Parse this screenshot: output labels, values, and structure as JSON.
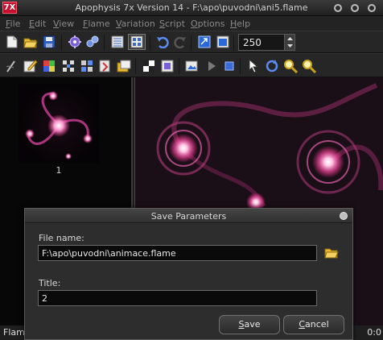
{
  "window": {
    "title": "Apophysis 7x Version 14 - F:\\apo\\puvodni\\ani5.flame",
    "icon_text": "7X"
  },
  "menu": [
    "File",
    "Edit",
    "View",
    "Flame",
    "Variation",
    "Script",
    "Options",
    "Help"
  ],
  "toolbar": {
    "spin_value": "250"
  },
  "thumbnails": [
    {
      "label": "1"
    }
  ],
  "status": {
    "left_text": "Flam",
    "right_text": "0:0"
  },
  "dialog": {
    "title": "Save Parameters",
    "file_label": "File name:",
    "file_value": "F:\\apo\\puvodni\\animace.flame",
    "title_label": "Title:",
    "title_value": "2",
    "save_label": "Save",
    "cancel_label": "Cancel"
  }
}
